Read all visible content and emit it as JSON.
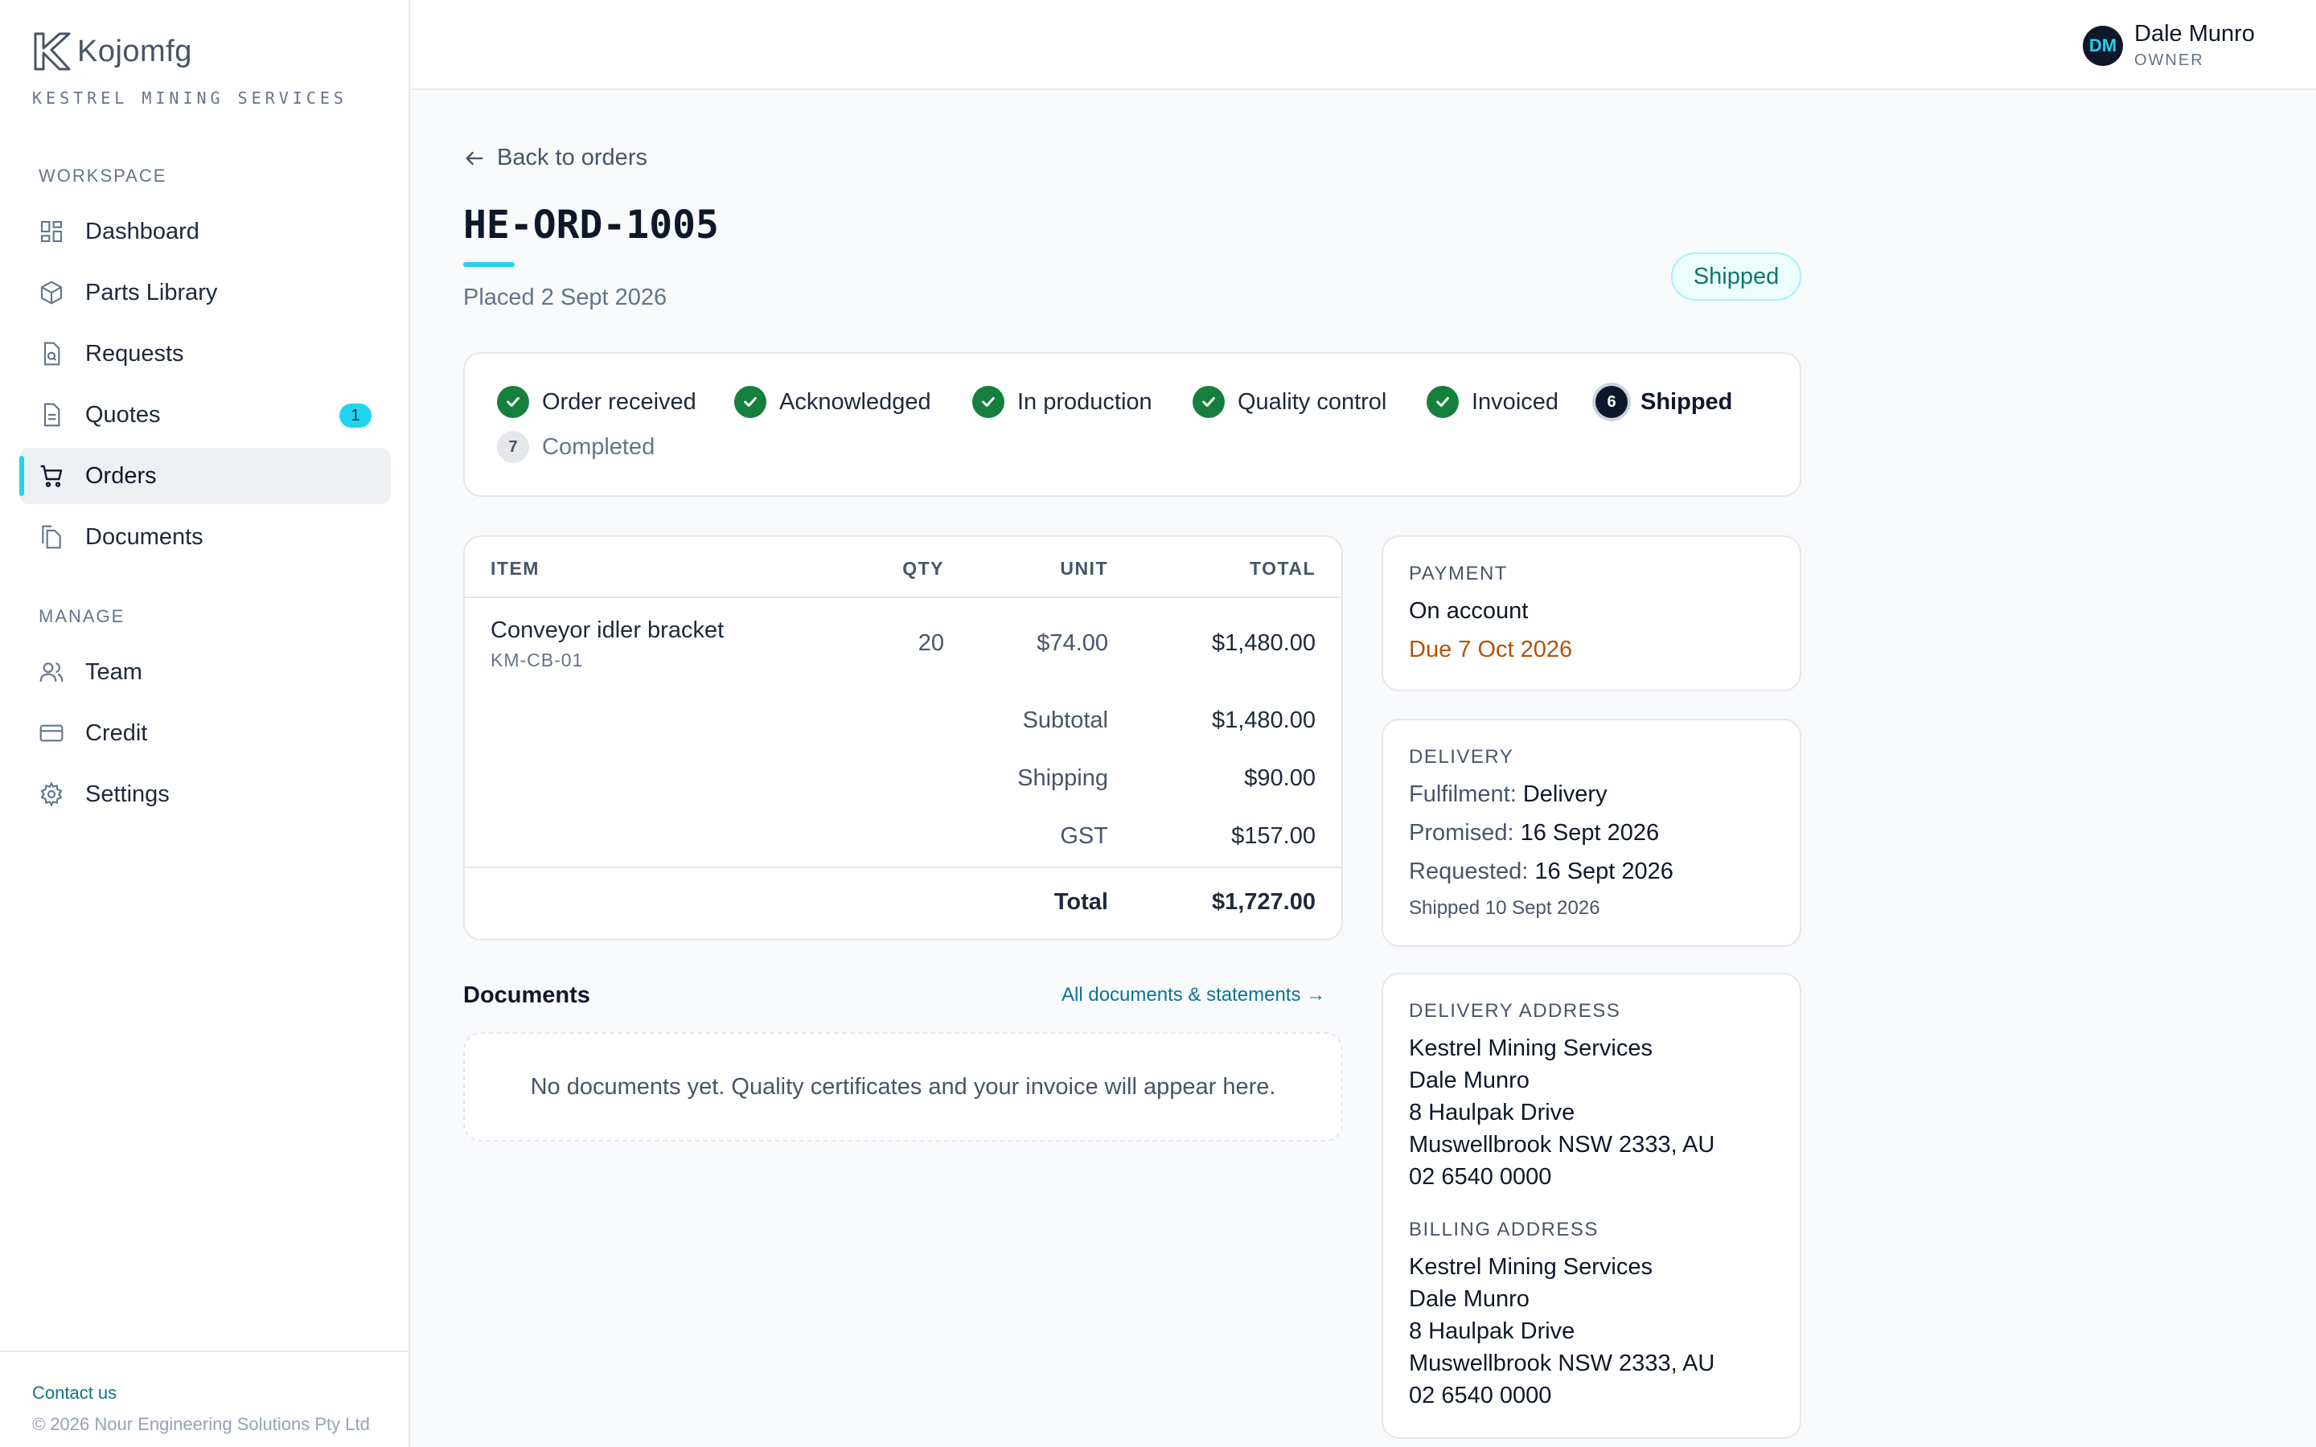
{
  "brand": {
    "name": "Kojomfg",
    "subtitle": "KESTREL MINING SERVICES"
  },
  "sidebar": {
    "workspace_label": "WORKSPACE",
    "manage_label": "MANAGE",
    "workspace_items": [
      {
        "label": "Dashboard",
        "icon": "dashboard-icon"
      },
      {
        "label": "Parts Library",
        "icon": "cube-icon"
      },
      {
        "label": "Requests",
        "icon": "document-search-icon"
      },
      {
        "label": "Quotes",
        "icon": "document-icon",
        "badge": "1"
      },
      {
        "label": "Orders",
        "icon": "cart-icon",
        "active": true
      },
      {
        "label": "Documents",
        "icon": "documents-icon"
      }
    ],
    "manage_items": [
      {
        "label": "Team",
        "icon": "users-icon"
      },
      {
        "label": "Credit",
        "icon": "credit-card-icon"
      },
      {
        "label": "Settings",
        "icon": "gear-icon"
      }
    ],
    "contact": "Contact us",
    "copyright": "© 2026 Nour Engineering Solutions Pty Ltd"
  },
  "user": {
    "initials": "DM",
    "name": "Dale Munro",
    "role": "OWNER"
  },
  "order": {
    "back_label": "Back to orders",
    "id": "HE-ORD-1005",
    "placed": "Placed 2 Sept 2026",
    "status": "Shipped"
  },
  "steps": [
    {
      "label": "Order received",
      "state": "done",
      "num": "1"
    },
    {
      "label": "Acknowledged",
      "state": "done",
      "num": "2"
    },
    {
      "label": "In production",
      "state": "done",
      "num": "3"
    },
    {
      "label": "Quality control",
      "state": "done",
      "num": "4"
    },
    {
      "label": "Invoiced",
      "state": "done",
      "num": "5"
    },
    {
      "label": "Shipped",
      "state": "current",
      "num": "6"
    },
    {
      "label": "Completed",
      "state": "pending",
      "num": "7"
    }
  ],
  "items_table": {
    "headers": {
      "item": "ITEM",
      "qty": "QTY",
      "unit": "UNIT",
      "total": "TOTAL"
    },
    "rows": [
      {
        "name": "Conveyor idler bracket",
        "sku": "KM-CB-01",
        "qty": "20",
        "unit": "$74.00",
        "total": "$1,480.00"
      }
    ],
    "subtotal_label": "Subtotal",
    "subtotal": "$1,480.00",
    "shipping_label": "Shipping",
    "shipping": "$90.00",
    "gst_label": "GST",
    "gst": "$157.00",
    "total_label": "Total",
    "total": "$1,727.00"
  },
  "documents": {
    "title": "Documents",
    "link": "All documents & statements →",
    "empty": "No documents yet. Quality certificates and your invoice will appear here."
  },
  "payment": {
    "label": "PAYMENT",
    "method": "On account",
    "due": "Due 7 Oct 2026"
  },
  "delivery": {
    "label": "DELIVERY",
    "fulfilment_key": "Fulfilment:",
    "fulfilment": "Delivery",
    "promised_key": "Promised:",
    "promised": "16 Sept 2026",
    "requested_key": "Requested:",
    "requested": "16 Sept 2026",
    "shipped": "Shipped 10 Sept 2026"
  },
  "addresses": {
    "delivery_label": "DELIVERY ADDRESS",
    "delivery": [
      "Kestrel Mining Services",
      "Dale Munro",
      "8 Haulpak Drive",
      "Muswellbrook NSW 2333, AU",
      "02 6540 0000"
    ],
    "billing_label": "BILLING ADDRESS",
    "billing": [
      "Kestrel Mining Services",
      "Dale Munro",
      "8 Haulpak Drive",
      "Muswellbrook NSW 2333, AU",
      "02 6540 0000"
    ]
  },
  "colors": {
    "accent": "#22d3ee",
    "success": "#15803d",
    "warning": "#b45309",
    "link": "#0e7490"
  }
}
